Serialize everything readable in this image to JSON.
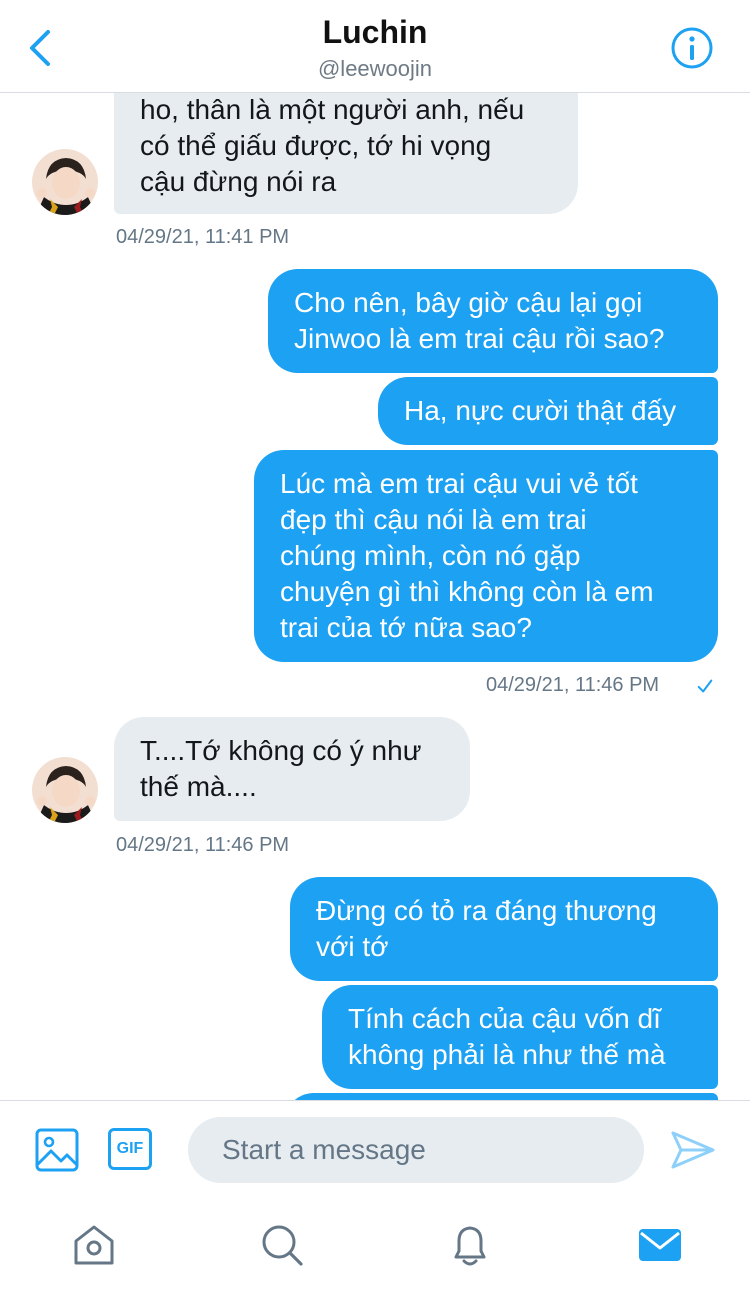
{
  "header": {
    "title": "Luchin",
    "handle": "@leewoojin",
    "back_icon": "chevron-left-icon",
    "info_icon": "info-icon"
  },
  "colors": {
    "accent": "#1da1f2",
    "incoming_bubble": "#e6ecf0",
    "timestamp": "#657786"
  },
  "messages": [
    {
      "direction": "in",
      "lines": [
        "ho, thân là một người anh, nếu",
        "có thể giấu được, tớ hi vọng",
        "cậu đừng nói ra"
      ]
    },
    {
      "timestamp": "04/29/21, 11:41 PM"
    },
    {
      "direction": "out",
      "lines": [
        "Cho nên, bây giờ cậu lại gọi",
        "Jinwoo là em trai cậu rồi sao?"
      ]
    },
    {
      "direction": "out",
      "lines": [
        "Ha, nực cười thật đấy"
      ]
    },
    {
      "direction": "out",
      "lines": [
        "Lúc mà em trai cậu vui vẻ tốt",
        "đẹp thì cậu nói là em trai",
        "chúng mình, còn nó gặp",
        "chuyện gì thì không còn là em",
        "trai của tớ nữa sao?"
      ]
    },
    {
      "timestamp": "04/29/21, 11:46 PM",
      "read_icon": "checkmark-icon"
    },
    {
      "direction": "in",
      "lines": [
        "T....Tớ không có ý như",
        "thế mà...."
      ]
    },
    {
      "timestamp": "04/29/21, 11:46 PM"
    },
    {
      "direction": "out",
      "lines": [
        "Đừng có tỏ ra đáng thương",
        "với tớ"
      ]
    },
    {
      "direction": "out",
      "lines": [
        "Tính cách của cậu vốn dĩ",
        "không phải là như thế mà"
      ]
    }
  ],
  "composer": {
    "placeholder": "Start a message",
    "image_icon": "image-icon",
    "gif_label": "GIF",
    "send_icon": "send-icon"
  },
  "tabbar": [
    "home-icon",
    "search-icon",
    "notifications-bell-icon",
    "messages-envelope-icon"
  ]
}
